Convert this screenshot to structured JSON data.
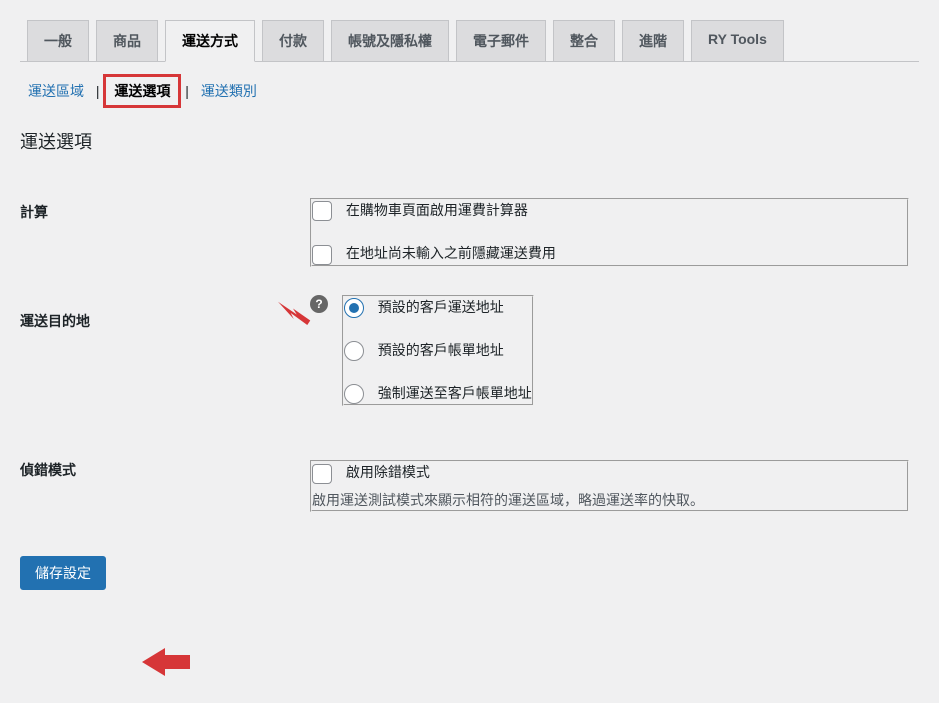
{
  "tabs": {
    "general": "一般",
    "products": "商品",
    "shipping": "運送方式",
    "checkout": "付款",
    "accounts": "帳號及隱私權",
    "email": "電子郵件",
    "integration": "整合",
    "advanced": "進階",
    "rytools": "RY Tools"
  },
  "subtabs": {
    "zones": "運送區域",
    "options": "運送選項",
    "classes": "運送類別"
  },
  "section_title": "運送選項",
  "labels": {
    "calculations": "計算",
    "destination": "運送目的地",
    "debug": "偵錯模式"
  },
  "options": {
    "enable_calculator": "在購物車頁面啟用運費計算器",
    "hide_until_address": "在地址尚未輸入之前隱藏運送費用",
    "default_shipping": "預設的客戶運送地址",
    "default_billing": "預設的客戶帳單地址",
    "force_billing": "強制運送至客戶帳單地址",
    "enable_debug": "啟用除錯模式",
    "debug_desc": "啟用運送測試模式來顯示相符的運送區域，略過運送率的快取。"
  },
  "help_tip": "?",
  "buttons": {
    "save": "儲存設定"
  }
}
